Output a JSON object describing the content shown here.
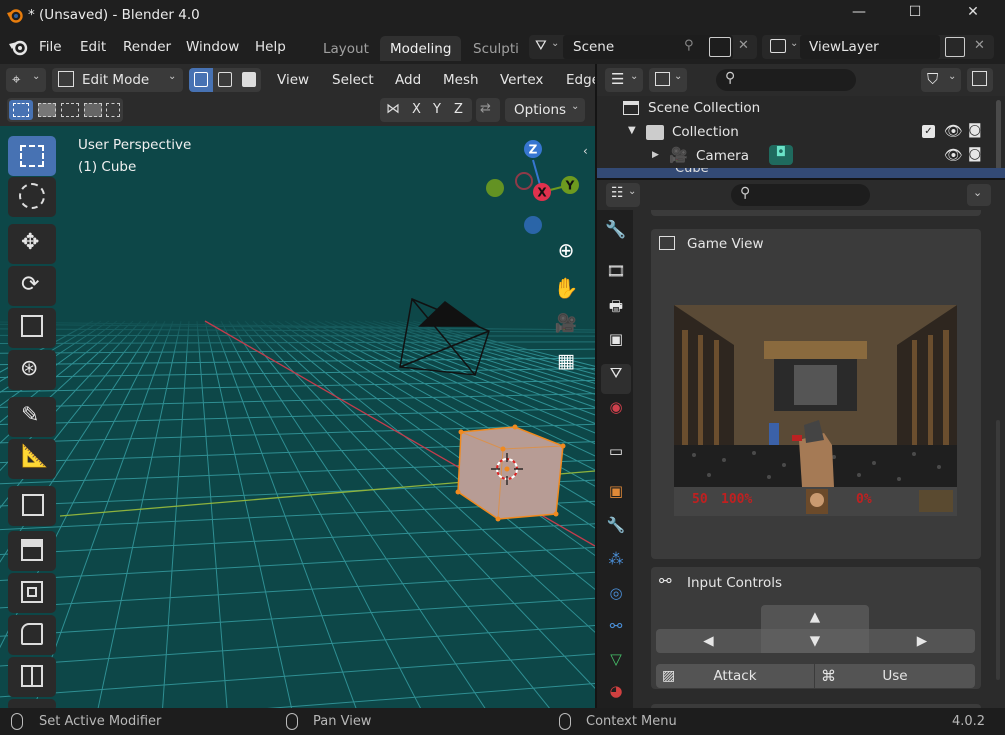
{
  "window": {
    "title": "* (Unsaved) - Blender 4.0",
    "minimize": "—",
    "maximize": "☐",
    "close": "✕"
  },
  "menubar": {
    "items": [
      "File",
      "Edit",
      "Render",
      "Window",
      "Help"
    ],
    "workspaces": [
      "Layout",
      "Modeling",
      "Sculpti"
    ],
    "active_workspace": "Modeling",
    "scene": "Scene",
    "view_layer": "ViewLayer"
  },
  "viewport_header": {
    "mode": "Edit Mode",
    "menus": [
      "View",
      "Select",
      "Add",
      "Mesh",
      "Vertex",
      "Edge"
    ],
    "axes": [
      "X",
      "Y",
      "Z"
    ],
    "options": "Options"
  },
  "viewport": {
    "perspective": "User Perspective",
    "object": "(1) Cube",
    "gizmo": {
      "z": "Z",
      "y": "Y",
      "x": "X"
    },
    "colors": {
      "background": "#0d4748",
      "grid": "#2f8f93",
      "x_axis": "#c43c4c",
      "y_axis": "#8db23d",
      "selection": "#f08a1f"
    }
  },
  "outliner": {
    "root": "Scene Collection",
    "collection": "Collection",
    "items": [
      "Camera",
      "Cube"
    ]
  },
  "properties": {
    "game_view_title": "Game View",
    "input_controls_title": "Input Controls",
    "arrows": {
      "up": "▲",
      "left": "◀",
      "down": "▼",
      "right": "▶"
    },
    "attack": "Attack",
    "use": "Use",
    "hud": {
      "ammo": "50",
      "health": "100%",
      "armor": "0%"
    }
  },
  "status": {
    "left": "Set Active Modifier",
    "middle": "Pan View",
    "right": "Context Menu",
    "version": "4.0.2"
  }
}
